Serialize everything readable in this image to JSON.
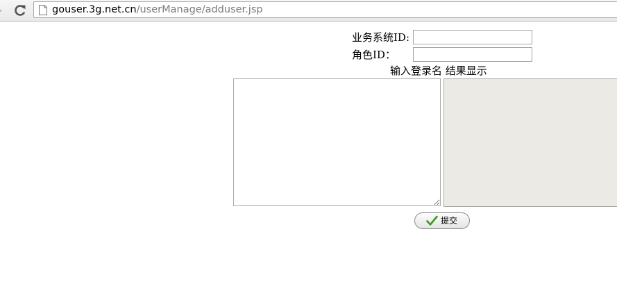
{
  "browser": {
    "url_host": "gouser.3g.net.cn",
    "url_path": "/userManage/adduser.jsp",
    "icons": {
      "forward": "arrow-right-icon",
      "reload": "reload-icon",
      "page": "page-icon"
    }
  },
  "form": {
    "business_id_label": "业务系统ID:",
    "business_id_value": "",
    "role_id_label": "角色ID：",
    "role_id_value": "",
    "textarea_caption": "输入登录名 结果显示",
    "login_names_value": "",
    "submit_label": "提交",
    "submit_icon": "checkmark-icon",
    "colors": {
      "result_background": "#ebeae4",
      "check_green": "#3c9a1e"
    }
  }
}
